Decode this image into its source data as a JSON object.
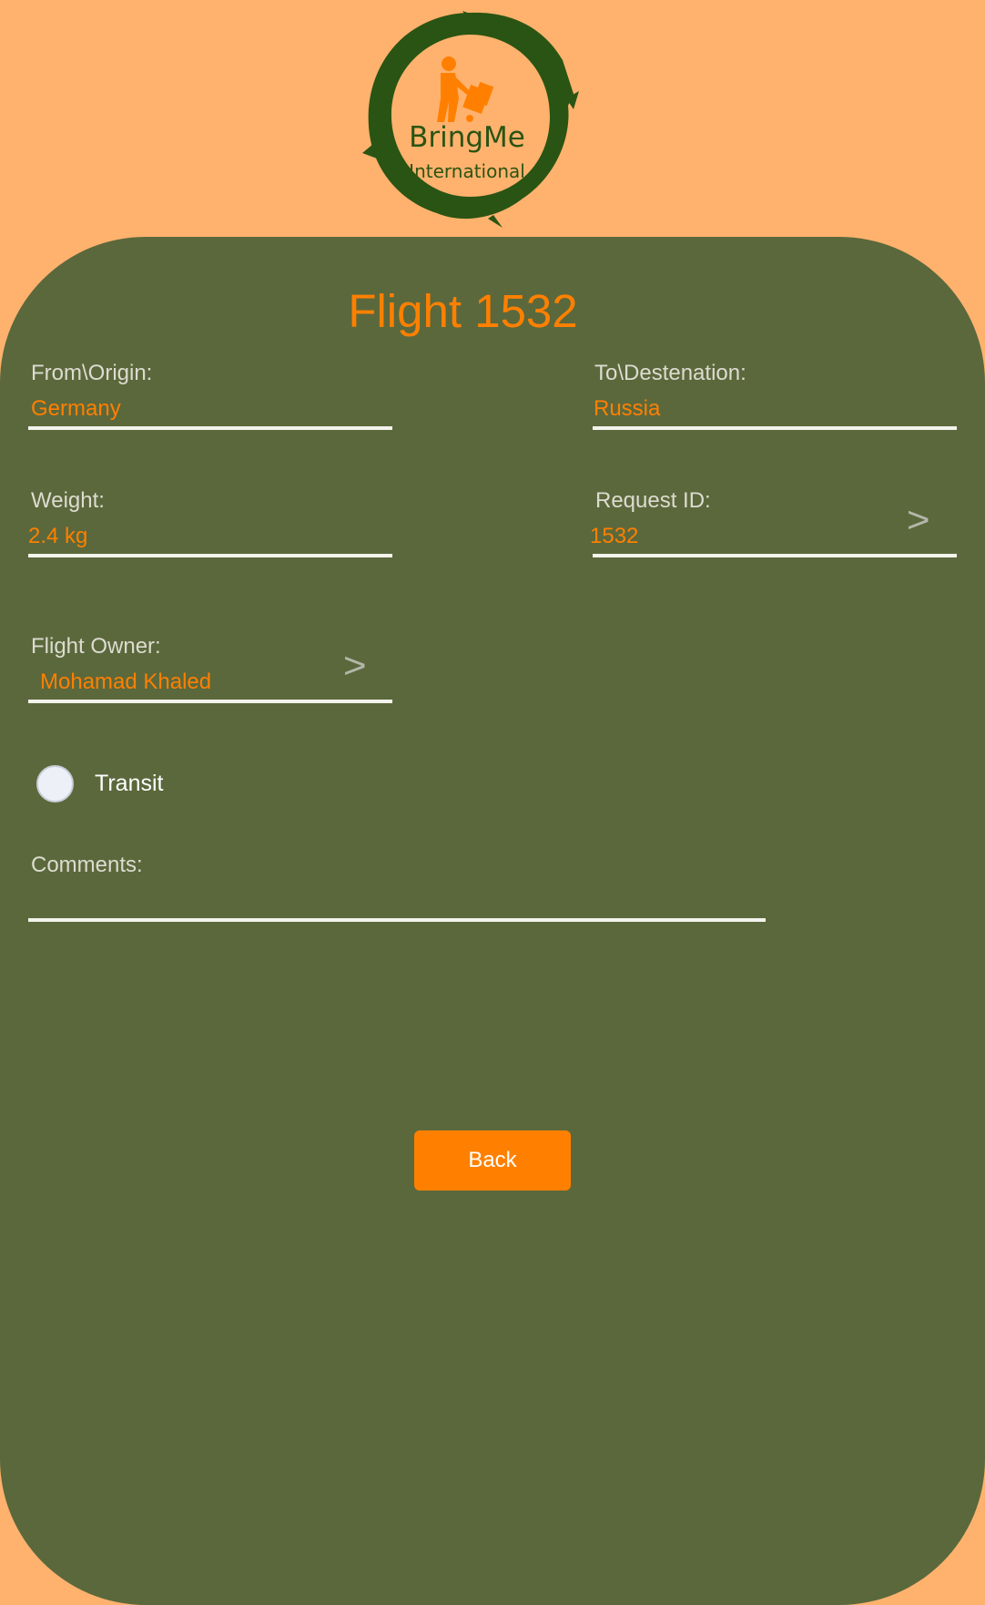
{
  "logo": {
    "brand": "BringMe",
    "subtitle": "International",
    "icon": "delivery-person-with-cart-icon"
  },
  "header": {
    "title": "Flight 1532"
  },
  "fields": {
    "origin": {
      "label": "From\\Origin:",
      "value": "Germany"
    },
    "destination": {
      "label": "To\\Destenation:",
      "value": "Russia"
    },
    "weight": {
      "label": "Weight:",
      "value": "2.4 kg"
    },
    "request_id": {
      "label": "Request ID:",
      "value": "1532",
      "action_icon": ">"
    },
    "flight_owner": {
      "label": "Flight Owner:",
      "value": "Mohamad Khaled",
      "action_icon": ">"
    },
    "comments": {
      "label": "Comments:",
      "value": ""
    }
  },
  "transit": {
    "label": "Transit",
    "checked": false
  },
  "actions": {
    "back_label": "Back"
  },
  "colors": {
    "background": "#ffb26e",
    "card": "#5b683c",
    "accent": "#ff8000",
    "logo_green": "#2a5413"
  }
}
